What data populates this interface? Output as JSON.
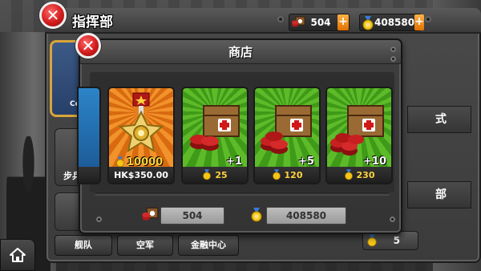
{
  "hq": {
    "title": "指挥部",
    "close_label": "✕",
    "side_card_label": "Co",
    "side_tiles": [
      {
        "label": "步兵"
      }
    ],
    "bottom_buttons": [
      {
        "label": "舰队"
      },
      {
        "label": "空军"
      },
      {
        "label": "金融中心"
      }
    ],
    "right_list": [
      {
        "label": "式"
      },
      {
        "label": "部"
      }
    ],
    "stat_value": "5"
  },
  "resources": {
    "supplies_value": "504",
    "medals_value": "408580",
    "plus_label": "+"
  },
  "shop": {
    "title": "商店",
    "close_label": "✕",
    "items": [
      {
        "kind": "medal-pack",
        "cost": "10000",
        "price": "HK$350.00"
      },
      {
        "kind": "supply-crate",
        "qty": "+1",
        "price": "25"
      },
      {
        "kind": "supply-crate",
        "qty": "+5",
        "price": "120"
      },
      {
        "kind": "supply-crate",
        "qty": "+10",
        "price": "230"
      }
    ],
    "footer": {
      "supplies": "504",
      "medals": "408580"
    }
  },
  "icons": {
    "supply": "supply-crate-icon",
    "medal": "medal-coin-icon",
    "home": "home-icon",
    "close": "close-icon"
  },
  "colors": {
    "accent_orange": "#e07000",
    "item_green": "#5dbb2a",
    "item_orange": "#f2922a",
    "close_red": "#d21c1c",
    "gold": "#ffd23c"
  }
}
